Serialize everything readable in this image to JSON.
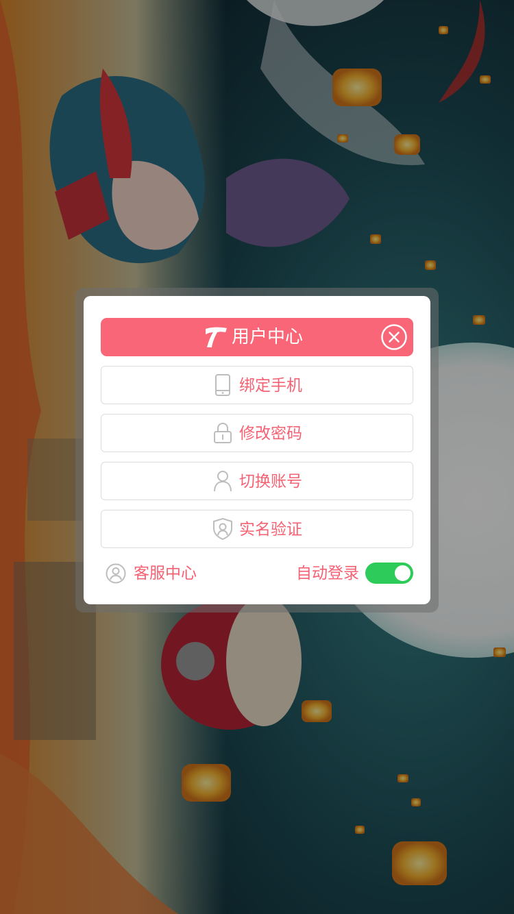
{
  "dialog": {
    "title": "用户中心",
    "menu": [
      {
        "label": "绑定手机",
        "icon": "phone-icon"
      },
      {
        "label": "修改密码",
        "icon": "lock-icon"
      },
      {
        "label": "切换账号",
        "icon": "user-icon"
      },
      {
        "label": "实名验证",
        "icon": "shield-user-icon"
      }
    ],
    "footer": {
      "service_label": "客服中心",
      "auto_login_label": "自动登录",
      "auto_login_enabled": true
    }
  },
  "colors": {
    "accent": "#f96677",
    "text_accent": "#f56273",
    "toggle_on": "#2ccb5a"
  }
}
